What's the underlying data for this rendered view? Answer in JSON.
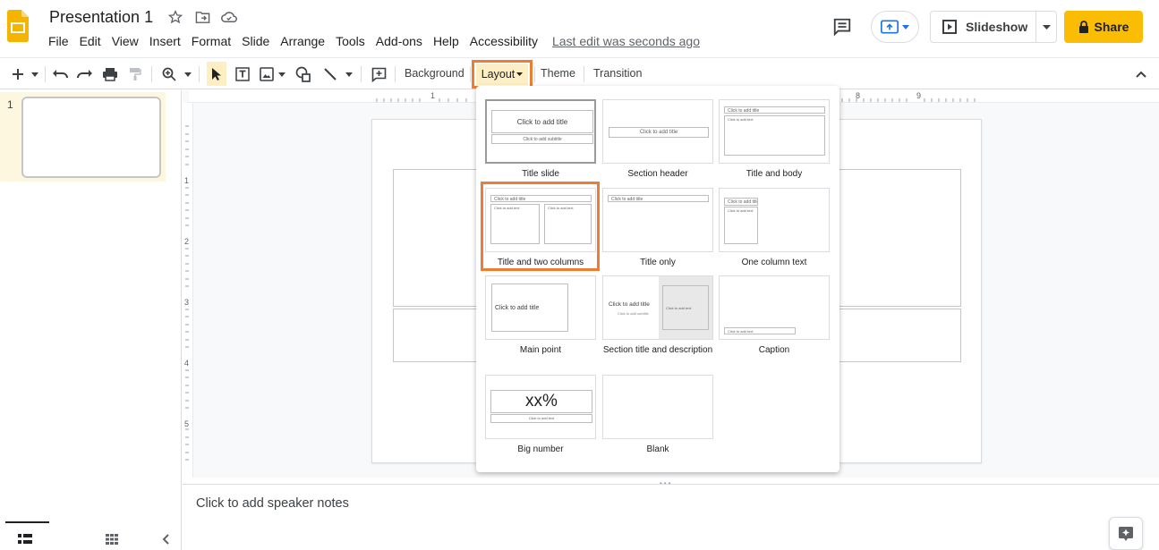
{
  "app": {
    "doc_title": "Presentation 1",
    "menu": [
      "File",
      "Edit",
      "View",
      "Insert",
      "Format",
      "Slide",
      "Arrange",
      "Tools",
      "Add-ons",
      "Help",
      "Accessibility"
    ],
    "last_edit": "Last edit was seconds ago",
    "slideshow_label": "Slideshow",
    "share_label": "Share",
    "accent_color": "#fbbc04",
    "highlight_color": "#ed7d31"
  },
  "toolbar": {
    "background_label": "Background",
    "layout_label": "Layout",
    "theme_label": "Theme",
    "transition_label": "Transition"
  },
  "ruler": {
    "top": [
      "1",
      "8",
      "9"
    ],
    "left": [
      "1",
      "2",
      "3",
      "4",
      "5"
    ]
  },
  "filmstrip": {
    "slide_number": "1"
  },
  "notes": {
    "placeholder": "Click to add speaker notes"
  },
  "layouts": {
    "title_slide": {
      "label": "Title slide",
      "title_text": "Click to add title",
      "subtitle_text": "Click to add subtitle"
    },
    "section_header": {
      "label": "Section header",
      "title_text": "Click to add title"
    },
    "title_and_body": {
      "label": "Title and body",
      "title_text": "Click to add title",
      "body_text": "Click to add text"
    },
    "title_two_columns": {
      "label": "Title and two columns",
      "title_text": "Click to add title",
      "col1_text": "Click to add text",
      "col2_text": "Click to add text"
    },
    "title_only": {
      "label": "Title only",
      "title_text": "Click to add title"
    },
    "one_column": {
      "label": "One column text",
      "title_text": "Click to add title",
      "body_text": "Click to add text"
    },
    "main_point": {
      "label": "Main point",
      "title_text": "Click to add title"
    },
    "section_desc": {
      "label": "Section title and description",
      "title_text": "Click to add title",
      "subtitle_text": "Click to add subtitle",
      "body_text": "Click to add text"
    },
    "caption": {
      "label": "Caption",
      "caption_text": "Click to add text"
    },
    "big_number": {
      "label": "Big number",
      "number_text": "xx%",
      "body_text": "Click to add text"
    },
    "blank": {
      "label": "Blank"
    }
  }
}
